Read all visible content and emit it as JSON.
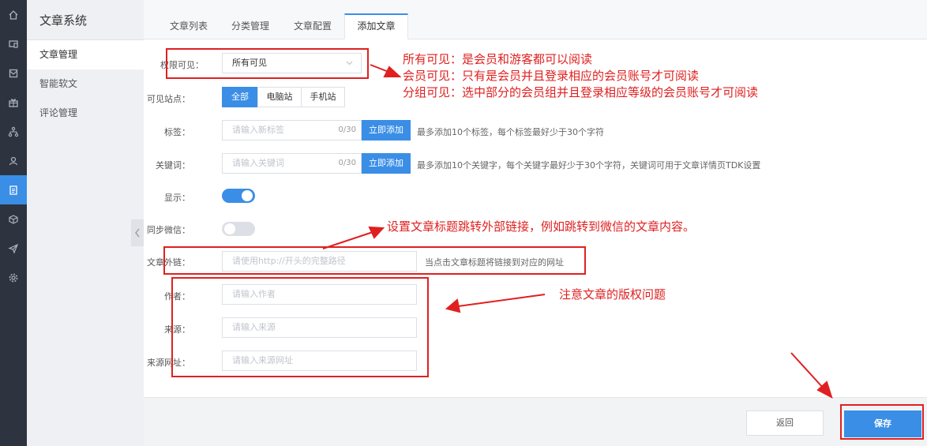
{
  "icon_bar": {
    "items": [
      {
        "icon": "home-icon"
      },
      {
        "icon": "monitor-icon"
      },
      {
        "icon": "mail-icon"
      },
      {
        "icon": "gift-icon"
      },
      {
        "icon": "network-icon"
      },
      {
        "icon": "users-icon"
      },
      {
        "icon": "document-icon"
      },
      {
        "icon": "cube-icon"
      },
      {
        "icon": "send-icon"
      },
      {
        "icon": "gear-icon"
      }
    ],
    "active_index": 6,
    "accent": "#3a8ee6"
  },
  "subnav": {
    "title": "文章系统",
    "items": [
      {
        "label": "文章管理"
      },
      {
        "label": "智能软文"
      },
      {
        "label": "评论管理"
      }
    ]
  },
  "tabs": [
    {
      "label": "文章列表"
    },
    {
      "label": "分类管理"
    },
    {
      "label": "文章配置"
    },
    {
      "label": "添加文章"
    }
  ],
  "form": {
    "permission": {
      "label": "权限可见：",
      "value": "所有可见"
    },
    "site": {
      "label": "可见站点：",
      "options": [
        "全部",
        "电脑站",
        "手机站"
      ],
      "selected": "全部"
    },
    "tags": {
      "label": "标签：",
      "placeholder": "请输入新标签",
      "count": "0/30",
      "button": "立即添加",
      "hint": "最多添加10个标签，每个标签最好少于30个字符"
    },
    "keywords": {
      "label": "关键词：",
      "placeholder": "请输入关键词",
      "count": "0/30",
      "button": "立即添加",
      "hint": "最多添加10个关键字，每个关键字最好少于30个字符，关键词可用于文章详情页TDK设置"
    },
    "display": {
      "label": "显示：",
      "on": true
    },
    "wechat_sync": {
      "label": "同步微信：",
      "on": false
    },
    "external_link": {
      "label": "文章外链：",
      "placeholder": "请使用http://开头的完整路径",
      "hint": "当点击文章标题将链接到对应的网址"
    },
    "author": {
      "label": "作者：",
      "placeholder": "请输入作者"
    },
    "source": {
      "label": "来源：",
      "placeholder": "请输入来源"
    },
    "source_url": {
      "label": "来源网址：",
      "placeholder": "请输入来源网址"
    }
  },
  "footer": {
    "back": "返回",
    "save": "保存"
  },
  "annotations": {
    "permission_note": [
      "所有可见：是会员和游客都可以阅读",
      "会员可见：只有是会员并且登录相应的会员账号才可阅读",
      "分组可见：选中部分的会员组并且登录相应等级的会员账号才可阅读"
    ],
    "link_note": "设置文章标题跳转外部链接，例如跳转到微信的文章内容。",
    "copyright_note": "注意文章的版权问题",
    "color": "#e02020"
  }
}
